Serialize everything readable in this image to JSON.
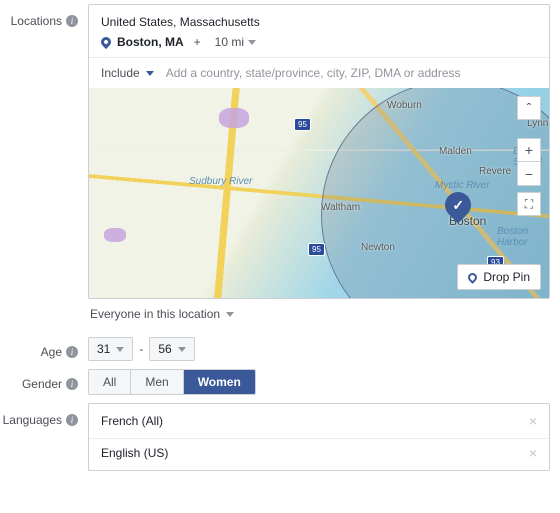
{
  "labels": {
    "locations": "Locations",
    "age": "Age",
    "gender": "Gender",
    "languages": "Languages"
  },
  "locations": {
    "region": "United States, Massachusetts",
    "selected_city": "Boston, MA",
    "radius": "10 mi",
    "include_label": "Include",
    "search_placeholder": "Add a country, state/province, city, ZIP, DMA or address",
    "scope": "Everyone in this location",
    "drop_pin": "Drop Pin",
    "map_places": {
      "boston": "Boston",
      "woburn": "Woburn",
      "lynn": "Lynn",
      "malden": "Malden",
      "revere": "Revere",
      "waltham": "Waltham",
      "newton": "Newton",
      "sudbury_river": "Sudbury River",
      "mystic_river": "Mystic River",
      "broad_sound": "Broad Sound",
      "boston_harbor": "Boston Harbor",
      "i95a": "95",
      "i95b": "95",
      "i93": "93"
    }
  },
  "age": {
    "min": "31",
    "max": "56",
    "separator": "-"
  },
  "gender": {
    "options": [
      "All",
      "Men",
      "Women"
    ],
    "selected": "Women"
  },
  "languages": {
    "items": [
      "French (All)",
      "English (US)"
    ]
  }
}
